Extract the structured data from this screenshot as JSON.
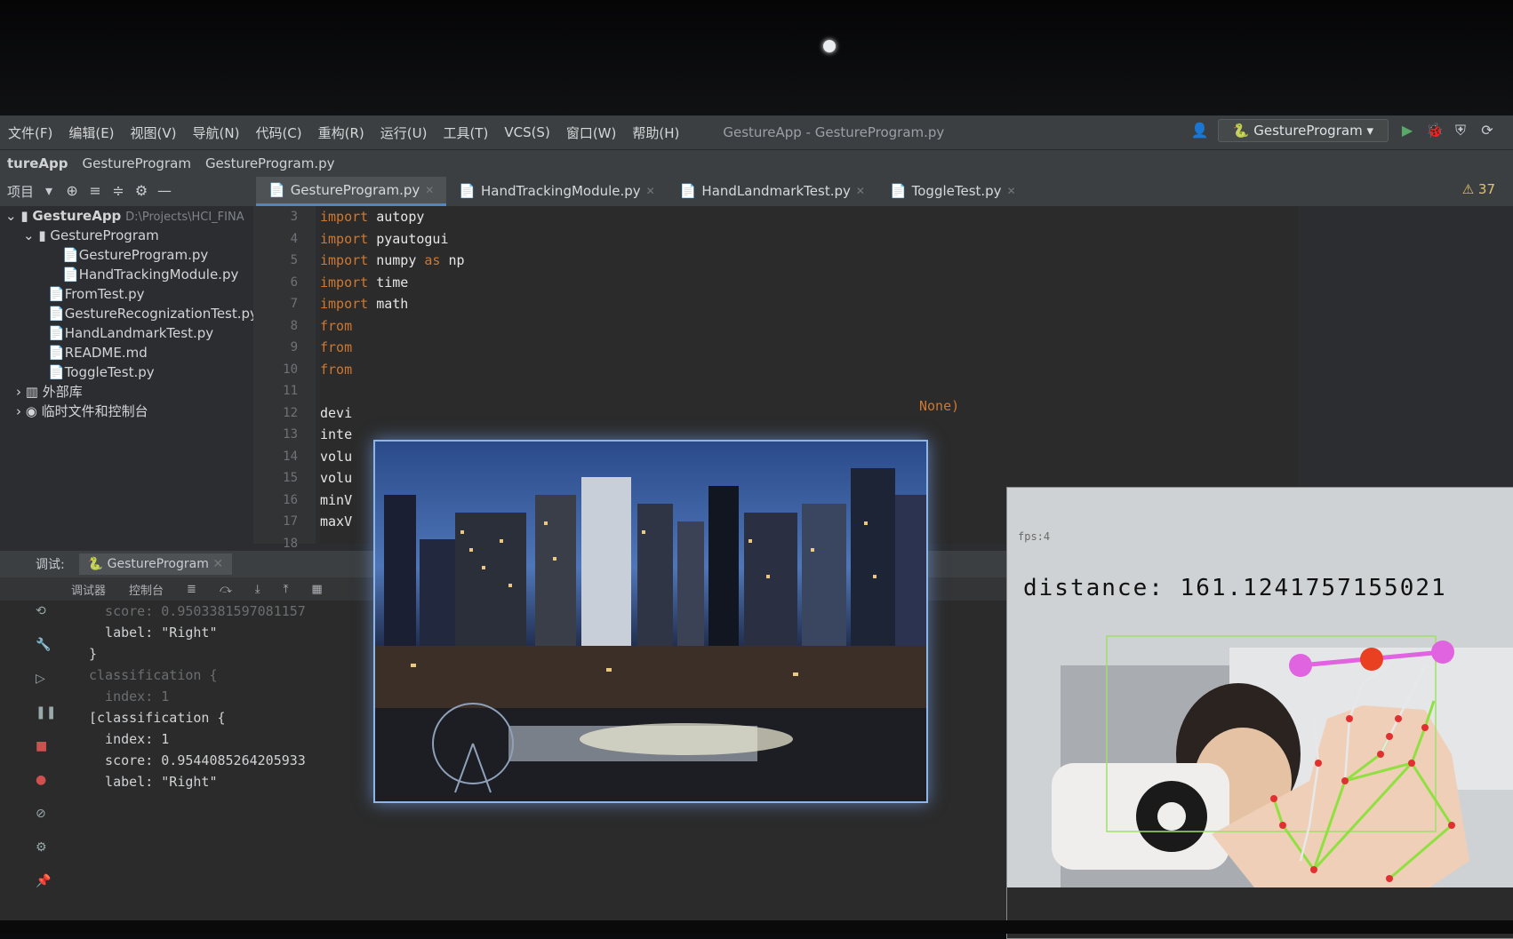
{
  "menu": [
    "文件(F)",
    "编辑(E)",
    "视图(V)",
    "导航(N)",
    "代码(C)",
    "重构(R)",
    "运行(U)",
    "工具(T)",
    "VCS(S)",
    "窗口(W)",
    "帮助(H)"
  ],
  "window_title": "GestureApp - GestureProgram.py",
  "run_config": "GestureProgram",
  "breadcrumb": [
    "tureApp",
    "GestureProgram",
    "GestureProgram.py"
  ],
  "project_label": "项目",
  "tabs": [
    {
      "label": "GestureProgram.py",
      "active": true
    },
    {
      "label": "HandTrackingModule.py"
    },
    {
      "label": "HandLandmarkTest.py"
    },
    {
      "label": "ToggleTest.py"
    }
  ],
  "warnings": "37",
  "tree": {
    "root": "GestureApp",
    "root_path": "D:\\Projects\\HCI_FINA",
    "folder": "GestureProgram",
    "items": [
      "GestureProgram.py",
      "HandTrackingModule.py",
      "FromTest.py",
      "GestureRecognizationTest.py",
      "HandLandmarkTest.py",
      "README.md",
      "ToggleTest.py"
    ],
    "ext_libs": "外部库",
    "scratches": "临时文件和控制台"
  },
  "line_numbers": [
    "3",
    "4",
    "5",
    "6",
    "7",
    "8",
    "9",
    "10",
    "11",
    "12",
    "13",
    "14",
    "15",
    "16",
    "17",
    "18"
  ],
  "code": [
    {
      "kw": "import",
      "rest": " autopy"
    },
    {
      "kw": "import",
      "rest": " pyautogui"
    },
    {
      "kw": "import",
      "rest": " numpy ",
      "kw2": "as",
      "rest2": " np"
    },
    {
      "kw": "import",
      "rest": " time"
    },
    {
      "kw": "import",
      "rest": " math"
    },
    {
      "kw": "from",
      "rest": ""
    },
    {
      "kw": "from",
      "rest": ""
    },
    {
      "kw": "from",
      "rest": ""
    },
    {
      "kw": "",
      "rest": ""
    },
    {
      "kw": "",
      "rest": "devi"
    },
    {
      "kw": "",
      "rest": "inte"
    },
    {
      "kw": "",
      "rest": "volu"
    },
    {
      "kw": "",
      "rest": "volu"
    },
    {
      "kw": "",
      "rest": "minV"
    },
    {
      "kw": "",
      "rest": "maxV"
    }
  ],
  "code_trailing": "None)",
  "debug": {
    "label": "调试:",
    "config": "GestureProgram",
    "tabs": [
      "调试器",
      "控制台"
    ],
    "console": [
      {
        "text": "  score: 0.9503381597081157",
        "faint": true
      },
      {
        "text": "  label: \"Right\""
      },
      {
        "text": "}"
      },
      {
        "text": "classification {",
        "faint": true
      },
      {
        "text": "  index: 1",
        "faint": true
      },
      {
        "text": "[classification {"
      },
      {
        "text": "  index: 1"
      },
      {
        "text": "  score: 0.9544085264205933"
      },
      {
        "text": "  label: \"Right\""
      }
    ]
  },
  "camera": {
    "fps": "fps:4",
    "distance_label": "distance:",
    "distance_value": "161.1241757155021"
  }
}
